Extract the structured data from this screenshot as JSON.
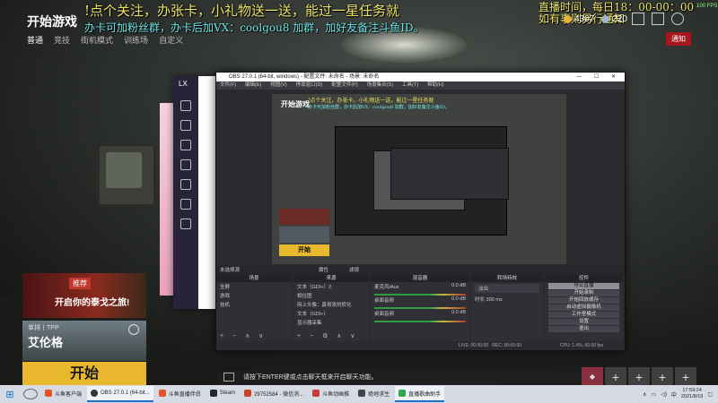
{
  "game": {
    "title": "开始游戏",
    "modes": [
      "普通",
      "竞技",
      "街机模式",
      "训练场",
      "自定义"
    ],
    "coins": "4307",
    "tickets": "220",
    "notice_label": "通知",
    "fps": "100 FPS"
  },
  "overlay": {
    "line1": "!点个关注，办张卡，小礼物送一送，能过一星任务就",
    "line2": "办卡可加粉丝群，办卡后加VX：coolgou8 加群，加好友备注斗鱼ID。",
    "line3": "直播时间，每日18：00-00：00",
    "line4": "如有事则另行通知"
  },
  "dy_window": {
    "label": "LX"
  },
  "obs": {
    "title": "OBS 27.0.1 (64-bit, windows) - 配置文件: 未命名 - 场景: 未命名",
    "menu": [
      "文件(F)",
      "编辑(E)",
      "视图(V)",
      "停靠窗口(D)",
      "配置文件(P)",
      "场景集合(S)",
      "工具(T)",
      "帮助(H)"
    ],
    "preview": {
      "title": "开始游戏",
      "line1": "!点个关注，办张卡，小礼物送一送，能过一星任务就",
      "line2": "办卡可加粉丝群，办卡后加VX：coolgou8 加群，加好友备注斗鱼ID。",
      "start": "开始"
    },
    "source_bar": {
      "text": "未选择源",
      "props": "属性",
      "filters": "滤镜"
    },
    "docks": {
      "scenes": {
        "header": "场景",
        "items": [
          "全屏",
          "游戏",
          "挂机"
        ]
      },
      "sources": {
        "header": "来源",
        "items": [
          "文本（GDI+）2",
          "相位图",
          "网上头像：鑫哥发的转化",
          "文本（GDI+）",
          "显示器采集"
        ]
      },
      "mixer": {
        "header": "混音器",
        "items": [
          {
            "name": "麦克风/Aux",
            "db": "0.0 dB"
          },
          {
            "name": "桌面音频",
            "db": "0.0 dB"
          },
          {
            "name": "桌面音频",
            "db": "0.0 dB"
          }
        ]
      },
      "transitions": {
        "header": "转场特效",
        "type": "淡出",
        "duration_label": "时长",
        "duration": "300 ms"
      },
      "controls": {
        "header": "控件",
        "buttons": [
          "停止直播",
          "开始录制",
          "开始回放缓存",
          "启动虚拟摄像机",
          "工作室模式",
          "设置",
          "退出"
        ]
      }
    },
    "status": {
      "live": "LIVE: 00:00:00",
      "rec": "REC: 00:00:00",
      "cpu": "CPU: 1.4%, 60.00 fps"
    }
  },
  "cards": {
    "recommend_badge": "推荐",
    "recommend_text": "开启你的泰戈之旅!",
    "map_mode": "单排丨TPP",
    "map_name": "艾伦格",
    "start": "开始"
  },
  "chat": {
    "placeholder": "请按下ENTER键或点击聊天框来开启聊天功能。"
  },
  "party": {
    "plus": "+",
    "add_friends": "+"
  },
  "taskbar": {
    "apps": [
      {
        "label": "斗鱼客户端",
        "color": "#e6532b"
      },
      {
        "label": "OBS 27.0.1 (64-bit...",
        "color": "#333333"
      },
      {
        "label": "斗鱼直播伴侣",
        "color": "#e6532b"
      },
      {
        "label": "Steam",
        "color": "#1b2838"
      },
      {
        "label": "29752584 - 微信消...",
        "color": "#c9432e"
      },
      {
        "label": "斗鱼动画推",
        "color": "#c93b2f"
      },
      {
        "label": "绝地求生",
        "color": "#444444"
      },
      {
        "label": "直播歌曲助手",
        "color": "#2fa84f"
      }
    ],
    "time": "17:59:24",
    "date": "2021/8/19",
    "lang": "中"
  }
}
